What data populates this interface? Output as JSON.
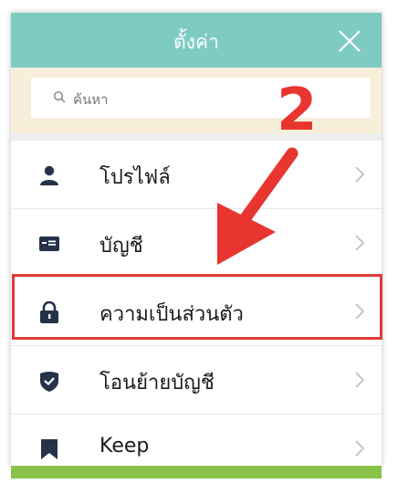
{
  "header": {
    "title": "ตั้งค่า",
    "close_icon": "close-icon"
  },
  "search": {
    "placeholder": "ค้นหา",
    "icon": "search-icon"
  },
  "menu": {
    "items": [
      {
        "label": "โปรไฟล์",
        "icon": "person-icon"
      },
      {
        "label": "บัญชี",
        "icon": "id-card-icon"
      },
      {
        "label": "ความเป็นส่วนตัว",
        "icon": "lock-icon"
      },
      {
        "label": "โอนย้ายบัญชี",
        "icon": "shield-check-icon"
      },
      {
        "label": "Keep",
        "icon": "bookmark-icon"
      }
    ]
  },
  "annotation": {
    "step_number": "2",
    "highlight_color": "#e53a3a"
  },
  "colors": {
    "header": "#7ecbc4",
    "search_area": "#f7efd9",
    "icon": "#26324a",
    "accent_green": "#8bc34a"
  }
}
